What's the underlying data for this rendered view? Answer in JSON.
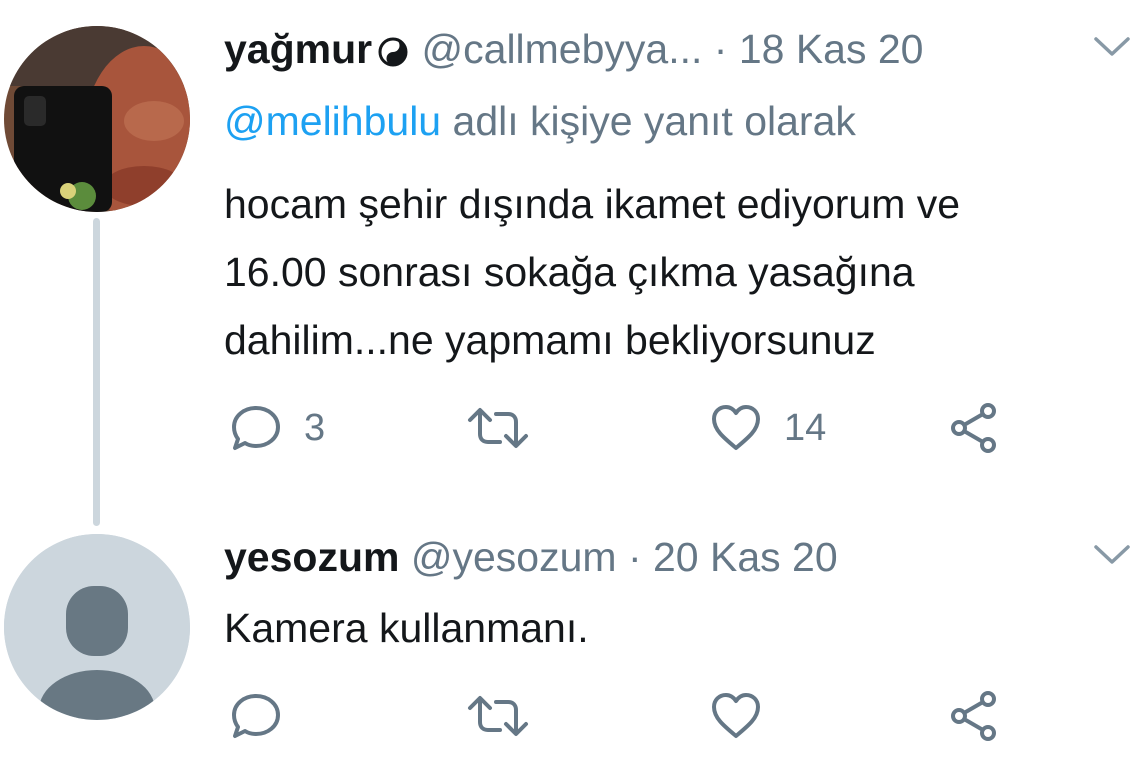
{
  "tweets": [
    {
      "display_name": "yağmur",
      "emoji_icon": "yin-yang-icon",
      "handle": "@callmebyya...",
      "date": "· 18 Kas 20",
      "reply_mention": "@melihbulu",
      "reply_suffix": " adlı kişiye yanıt olarak",
      "text_lines": [
        "hocam şehir dışında ikamet ediyorum ve",
        "16.00 sonrası sokağa çıkma yasağına",
        "dahilim...ne yapmamı bekliyorsunuz"
      ],
      "reply_count": "3",
      "retweet_count": "",
      "like_count": "14"
    },
    {
      "display_name": "yesozum",
      "handle": "@yesozum",
      "date": "· 20 Kas 20",
      "text_lines": [
        "Kamera kullanmanı."
      ],
      "reply_count": "",
      "retweet_count": "",
      "like_count": ""
    }
  ],
  "colors": {
    "text": "#14171a",
    "secondary": "#657786",
    "link": "#1da1f2",
    "thread_line": "#ccd6dd"
  }
}
